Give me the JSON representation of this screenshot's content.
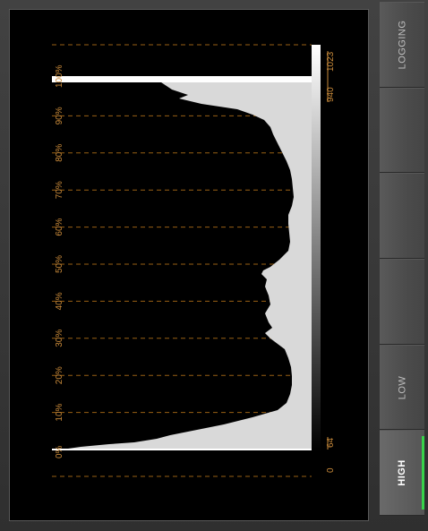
{
  "histogram": {
    "percent_labels": [
      "0%",
      "10%",
      "20%",
      "30%",
      "40%",
      "50%",
      "60%",
      "70%",
      "80%",
      "90%",
      "100%"
    ],
    "code_low": "0",
    "legal_low": "64",
    "legal_high": "940",
    "code_high": "1023",
    "grid_color": "#c0781a",
    "fill_color": "#d9d9d9"
  },
  "side_buttons": [
    {
      "id": "logging",
      "label": "LOGGING",
      "active": false
    },
    {
      "id": "blank1",
      "label": "",
      "active": false
    },
    {
      "id": "blank2",
      "label": "",
      "active": false
    },
    {
      "id": "blank3",
      "label": "",
      "active": false
    },
    {
      "id": "low",
      "label": "LOW",
      "active": false
    },
    {
      "id": "high",
      "label": "HIGH",
      "active": true
    }
  ]
}
